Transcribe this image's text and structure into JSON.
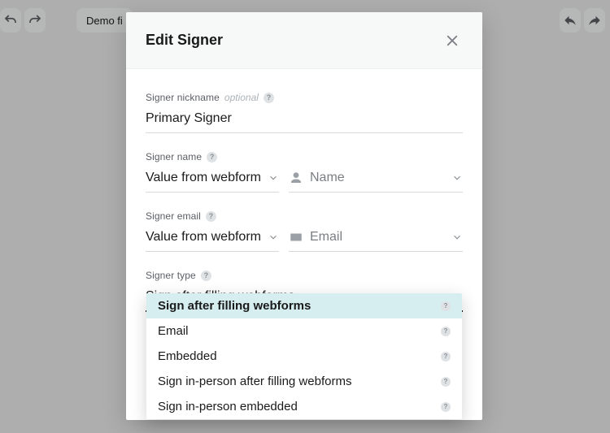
{
  "background": {
    "demo_label": "Demo fi"
  },
  "modal": {
    "title": "Edit Signer",
    "fields": {
      "nickname": {
        "label": "Signer nickname",
        "optional": "optional",
        "value": "Primary Signer"
      },
      "name": {
        "label": "Signer name",
        "source_select": "Value from webform",
        "value_placeholder": "Name"
      },
      "email": {
        "label": "Signer email",
        "source_select": "Value from webform",
        "value_placeholder": "Email"
      },
      "type": {
        "label": "Signer type",
        "value": "Sign after filling webforms"
      }
    }
  },
  "dropdown": {
    "options": [
      "Sign after filling webforms",
      "Email",
      "Embedded",
      "Sign in-person after filling webforms",
      "Sign in-person embedded"
    ],
    "selected_index": 0
  },
  "glyphs": {
    "help": "?"
  }
}
